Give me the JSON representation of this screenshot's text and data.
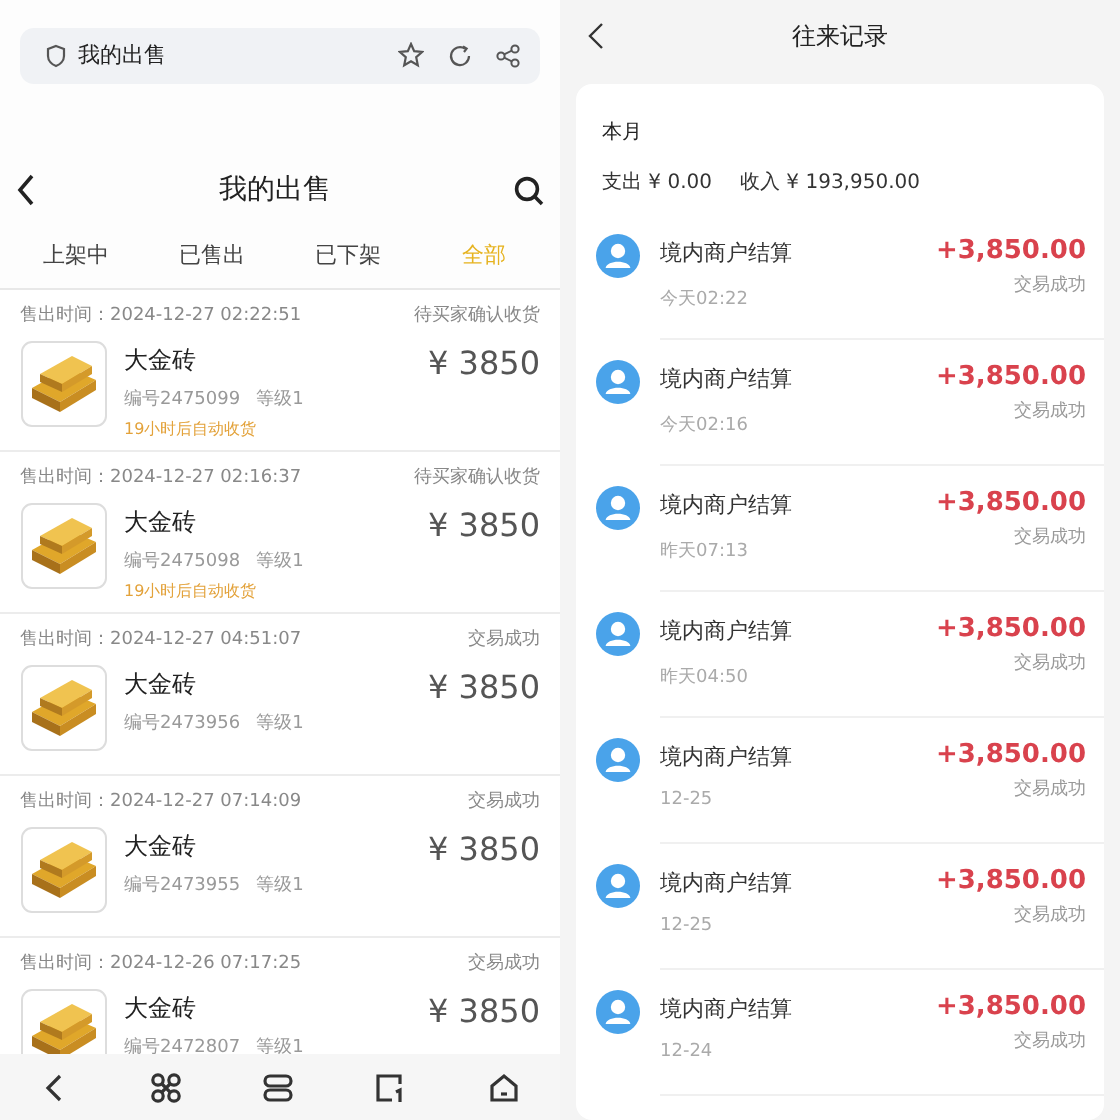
{
  "left_screen": {
    "browser_bar": {
      "title": "我的出售"
    },
    "header": {
      "title": "我的出售"
    },
    "tabs": [
      {
        "label": "上架中",
        "selected": false
      },
      {
        "label": "已售出",
        "selected": false
      },
      {
        "label": "已下架",
        "selected": false
      },
      {
        "label": "全部",
        "selected": true
      }
    ],
    "orders": [
      {
        "sold_time": "售出时间：2024-12-27 02:22:51",
        "status": "待买家确认收货",
        "name": "大金砖",
        "price": "¥ 3850",
        "serial": "编号2475099",
        "grade": "等级1",
        "note": "19小时后自动收货"
      },
      {
        "sold_time": "售出时间：2024-12-27 02:16:37",
        "status": "待买家确认收货",
        "name": "大金砖",
        "price": "¥ 3850",
        "serial": "编号2475098",
        "grade": "等级1",
        "note": "19小时后自动收货"
      },
      {
        "sold_time": "售出时间：2024-12-27 04:51:07",
        "status": "交易成功",
        "name": "大金砖",
        "price": "¥ 3850",
        "serial": "编号2473956",
        "grade": "等级1"
      },
      {
        "sold_time": "售出时间：2024-12-27 07:14:09",
        "status": "交易成功",
        "name": "大金砖",
        "price": "¥ 3850",
        "serial": "编号2473955",
        "grade": "等级1"
      },
      {
        "sold_time": "售出时间：2024-12-26 07:17:25",
        "status": "交易成功",
        "name": "大金砖",
        "price": "¥ 3850",
        "serial": "编号2472807",
        "grade": "等级1"
      }
    ]
  },
  "right_screen": {
    "header": {
      "title": "往来记录"
    },
    "summary": {
      "period": "本月",
      "expense": "支出 ¥ 0.00",
      "income": "收入 ¥ 193,950.00"
    },
    "records": [
      {
        "title": "境内商户结算",
        "time": "今天02:22",
        "amount": "+3,850.00",
        "status": "交易成功"
      },
      {
        "title": "境内商户结算",
        "time": "今天02:16",
        "amount": "+3,850.00",
        "status": "交易成功"
      },
      {
        "title": "境内商户结算",
        "time": "昨天07:13",
        "amount": "+3,850.00",
        "status": "交易成功"
      },
      {
        "title": "境内商户结算",
        "time": "昨天04:50",
        "amount": "+3,850.00",
        "status": "交易成功"
      },
      {
        "title": "境内商户结算",
        "time": "12-25",
        "amount": "+3,850.00",
        "status": "交易成功"
      },
      {
        "title": "境内商户结算",
        "time": "12-25",
        "amount": "+3,850.00",
        "status": "交易成功"
      },
      {
        "title": "境内商户结算",
        "time": "12-24",
        "amount": "+3,850.00",
        "status": "交易成功"
      }
    ]
  }
}
